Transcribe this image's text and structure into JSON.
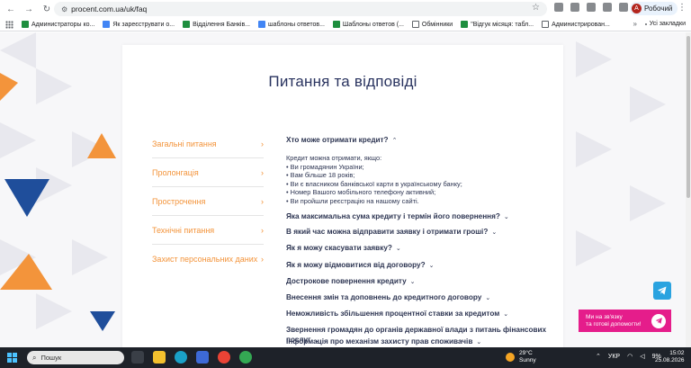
{
  "browser": {
    "url": "procent.com.ua/uk/faq",
    "profile_initial": "А",
    "profile_name": "Робочий",
    "bookmarks": [
      {
        "label": "Администраторы ко...",
        "icon": "sheet-icon"
      },
      {
        "label": "Як зареєструвати о...",
        "icon": "docs-icon"
      },
      {
        "label": "Відділення Банків...",
        "icon": "sheet-icon"
      },
      {
        "label": "шаблоны ответов...",
        "icon": "docs-icon"
      },
      {
        "label": "Шаблоны ответов (...",
        "icon": "sheet-icon"
      },
      {
        "label": "Обмінники",
        "icon": "folder-icon"
      },
      {
        "label": "\"Відгук місяця: табл...",
        "icon": "sheet-icon"
      },
      {
        "label": "Администрирован...",
        "icon": "folder-icon"
      }
    ],
    "more": "»",
    "all_bookmarks": "Усі закладки"
  },
  "page": {
    "title": "Питання та відповіді",
    "categories": [
      {
        "label": "Загальні питання"
      },
      {
        "label": "Пролонгація"
      },
      {
        "label": "Прострочення"
      },
      {
        "label": "Технічні питання"
      },
      {
        "label": "Захист персональних даних"
      }
    ],
    "open_question": "Хто може отримати кредит?",
    "answer_lines": [
      "Кредит можна отримати, якщо:",
      "• Ви громадянин України;",
      "• Вам більше 18 років;",
      "• Ви є власником банківської карти в українському банку;",
      "• Номер Вашого мобільного телефону активний;",
      "• Ви пройшли реєстрацію на нашому сайті."
    ],
    "questions": [
      "Яка максимальна сума кредиту і термін його повернення?",
      "В який час можна відправити заявку і отримати гроші?",
      "Як я можу скасувати заявку?",
      "Як я можу відмовитися від договору?",
      "Дострокове повернення кредиту",
      "Внесення змін та доповнень до кредитного договору",
      "Неможливість збільшення процентної ставки за кредитом",
      "Звернення громадян до органів державної влади з питань фінансових",
      "Інформація про механізм захисту прав споживачів"
    ],
    "question_wrap_line": "послуг",
    "help_line1": "Ми на зв'язку",
    "help_line2": "та готові допомогти!"
  },
  "taskbar": {
    "search_placeholder": "Пошук",
    "temperature": "29°C",
    "weather": "Sunny",
    "lang": "УКР",
    "battery": "9%",
    "time": "15:02",
    "date": "25.08.2026"
  },
  "colors": {
    "accent_orange": "#f3943b",
    "navy": "#29335f",
    "help_pink": "#e51d8b",
    "telegram": "#2aa3e0"
  }
}
